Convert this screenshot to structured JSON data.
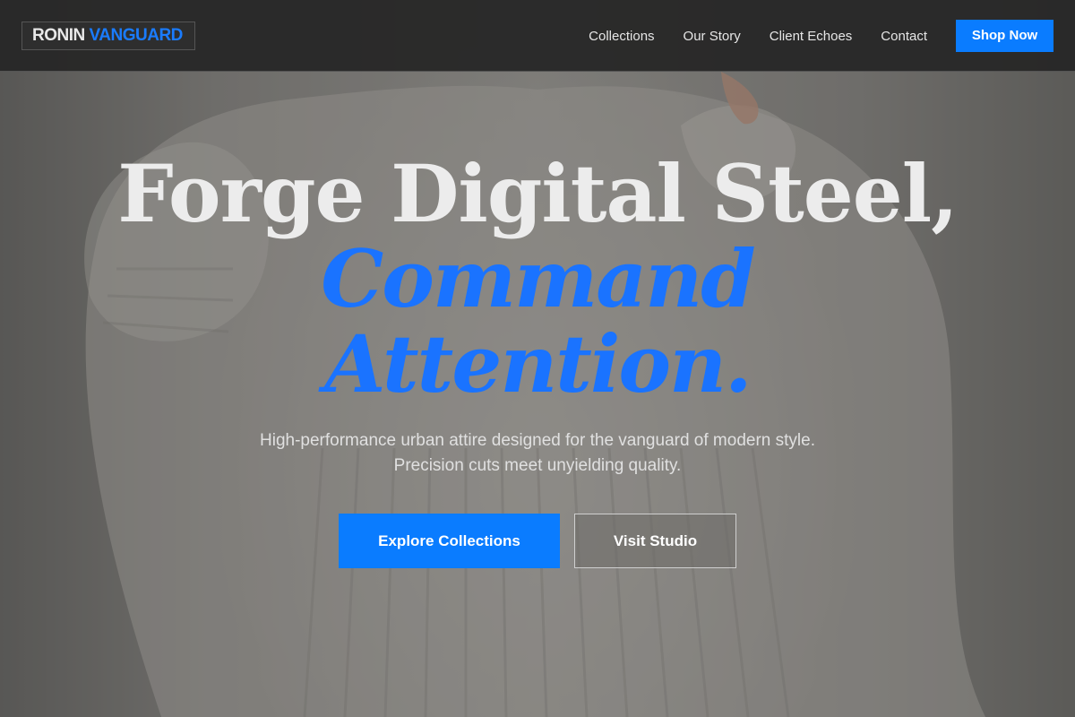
{
  "brand": {
    "name_part1": "RONIN",
    "name_part2": "VANGUARD",
    "accent_color": "#0a7cff"
  },
  "nav": {
    "links": [
      {
        "label": "Collections"
      },
      {
        "label": "Our Story"
      },
      {
        "label": "Client Echoes"
      },
      {
        "label": "Contact"
      }
    ],
    "cta_label": "Shop Now"
  },
  "hero": {
    "headline_line1": "Forge Digital Steel,",
    "headline_line2": "Command",
    "headline_line3": "Attention.",
    "subtext": "High-performance urban attire designed for the vanguard of modern style. Precision cuts meet unyielding quality.",
    "primary_button": "Explore Collections",
    "secondary_button": "Visit Studio",
    "background_image": "knit-sweater-photo"
  }
}
